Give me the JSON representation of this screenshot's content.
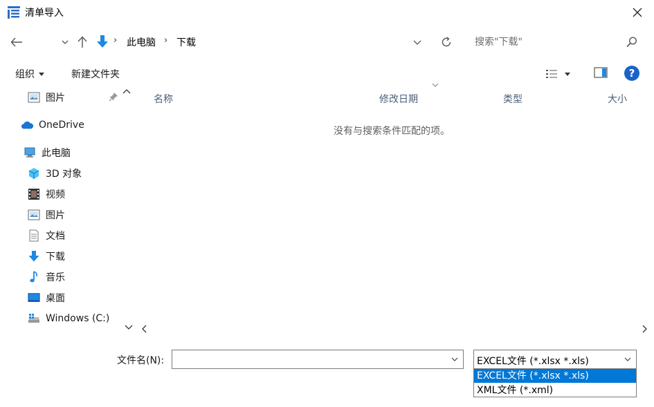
{
  "window": {
    "title": "清单导入"
  },
  "address": {
    "crumbs": [
      "此电脑",
      "下载"
    ],
    "separator": "›"
  },
  "search": {
    "placeholder": "搜索\"下载\""
  },
  "toolbar": {
    "organize_label": "组织",
    "new_folder_label": "新建文件夹",
    "help_label": "?"
  },
  "nav": {
    "quick_access": [
      {
        "label": "图片",
        "icon": "pictures-icon"
      }
    ],
    "onedrive": {
      "label": "OneDrive",
      "icon": "onedrive-cloud-icon"
    },
    "this_pc": {
      "label": "此电脑",
      "icon": "this-pc-icon"
    },
    "pc_items": [
      {
        "label": "3D 对象",
        "icon": "3d-objects-icon"
      },
      {
        "label": "视频",
        "icon": "videos-icon"
      },
      {
        "label": "图片",
        "icon": "pictures-icon"
      },
      {
        "label": "文档",
        "icon": "documents-icon"
      },
      {
        "label": "下载",
        "icon": "downloads-icon"
      },
      {
        "label": "音乐",
        "icon": "music-icon"
      },
      {
        "label": "桌面",
        "icon": "desktop-icon"
      },
      {
        "label": "Windows (C:)",
        "icon": "drive-icon"
      }
    ]
  },
  "columns": {
    "name": "名称",
    "modified": "修改日期",
    "type": "类型",
    "size": "大小"
  },
  "content": {
    "empty_message": "没有与搜索条件匹配的项。"
  },
  "file_name": {
    "label": "文件名(N):",
    "value": ""
  },
  "file_type": {
    "selected": "EXCEL文件 (*.xlsx *.xls)",
    "options": [
      "EXCEL文件 (*.xlsx *.xls)",
      "XML文件 (*.xml)"
    ]
  },
  "colors": {
    "accent": "#0078d7",
    "folder_blue": "#1e88e5",
    "help_blue": "#1a63c8"
  }
}
